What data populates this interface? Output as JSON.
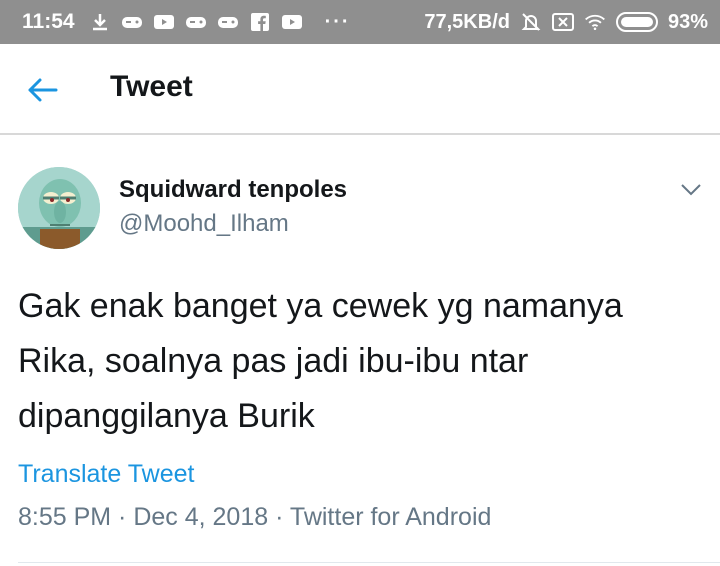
{
  "status_bar": {
    "time": "11:54",
    "network_speed": "77,5KB/d",
    "battery_percent": "93%",
    "overflow": "···",
    "icons": [
      "download-icon",
      "gamepad-icon",
      "youtube-icon",
      "gamepad-icon",
      "gamepad-icon",
      "facebook-icon",
      "youtube-icon",
      "alarm-off-icon",
      "sim-icon",
      "wifi-icon",
      "battery-icon"
    ]
  },
  "header": {
    "title": "Tweet",
    "back_icon": "arrow-left-icon"
  },
  "tweet": {
    "author_name": "Squidward tenpoles",
    "author_handle": "@Moohd_Ilham",
    "text_lines": [
      "Gak enak banget ya cewek yg namanya",
      "Rika, soalnya pas jadi ibu-ibu ntar",
      "dipanggilanya Burik"
    ],
    "translate_label": "Translate Tweet",
    "time": "8:55 PM",
    "separator": " · ",
    "date": "Dec 4, 2018",
    "source": "Twitter for Android"
  },
  "colors": {
    "accent": "#1b95e0",
    "secondary_text": "#657786",
    "status_bar": "#8f8f8f"
  }
}
